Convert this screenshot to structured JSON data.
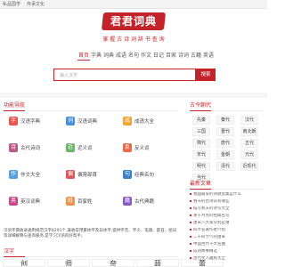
{
  "topbar": {
    "left": "私品国学",
    "right": "传承文化"
  },
  "logo": {
    "text": "君君词典"
  },
  "slogan": "掌 握 古 诗 词 辞 书 查 询",
  "nav": [
    "首页",
    "字典",
    "词典",
    "成语",
    "名句",
    "作文",
    "日记",
    "百家",
    "诗词",
    "古籍",
    "英语"
  ],
  "search": {
    "placeholder": "输入汉字",
    "button": "搜索"
  },
  "functions": {
    "title": "功能导航",
    "items": [
      {
        "label": "汉语字典",
        "color": "#e8564a",
        "glyph": "字"
      },
      {
        "label": "汉语词典",
        "color": "#4a90d9",
        "glyph": "词"
      },
      {
        "label": "成语大全",
        "color": "#f0a331",
        "glyph": "成"
      },
      {
        "label": "古代诗词",
        "color": "#b95a88",
        "glyph": "诗"
      },
      {
        "label": "近义词",
        "color": "#6bb56b",
        "glyph": "近"
      },
      {
        "label": "反义词",
        "color": "#e86a4a",
        "glyph": "反"
      },
      {
        "label": "作文大全",
        "color": "#5aa0d8",
        "glyph": "作"
      },
      {
        "label": "偏旁部首",
        "color": "#d95a5a",
        "glyph": "偏"
      },
      {
        "label": "经典名句",
        "color": "#3b7fc4",
        "glyph": "句"
      },
      {
        "label": "英汉词典",
        "color": "#c44a8a",
        "glyph": "英"
      },
      {
        "label": "百家姓",
        "color": "#e8944a",
        "glyph": "姓"
      },
      {
        "label": "古代典籍",
        "color": "#8a5ac4",
        "glyph": "籍"
      }
    ]
  },
  "intro": "汉语字典收录通用规范汉字8291个,兼收常用繁体字及异体字,提供字音、字义、笔顺、部首、组词等详细解释与查询服务,是学习汉语的好帮手。",
  "chars": {
    "title": "汉字",
    "items": [
      "创",
      "师",
      "奈",
      "蔬",
      "蕾"
    ]
  },
  "dynasty": {
    "title": "古今朝代",
    "items": [
      "先秦",
      "秦代",
      "汉代",
      "三国",
      "晋代",
      "南北朝",
      "隋代",
      "唐代",
      "五代",
      "宋代",
      "金朝",
      "元代",
      "明代",
      "清代",
      "近现代",
      "当代"
    ]
  },
  "recommend": {
    "title": "最新文章",
    "items": [
      "我国最早的诗歌总集是什么",
      "春天的古诗词有哪些",
      "描写秋天的诗句大全",
      "关于月亮的经典名句",
      "唐宋八大家分别是谁",
      "四大名著作者介绍",
      "二十四节气的由来",
      "中国古代十大名曲",
      "成语故事精选",
      "古代文人雅称大全"
    ]
  }
}
